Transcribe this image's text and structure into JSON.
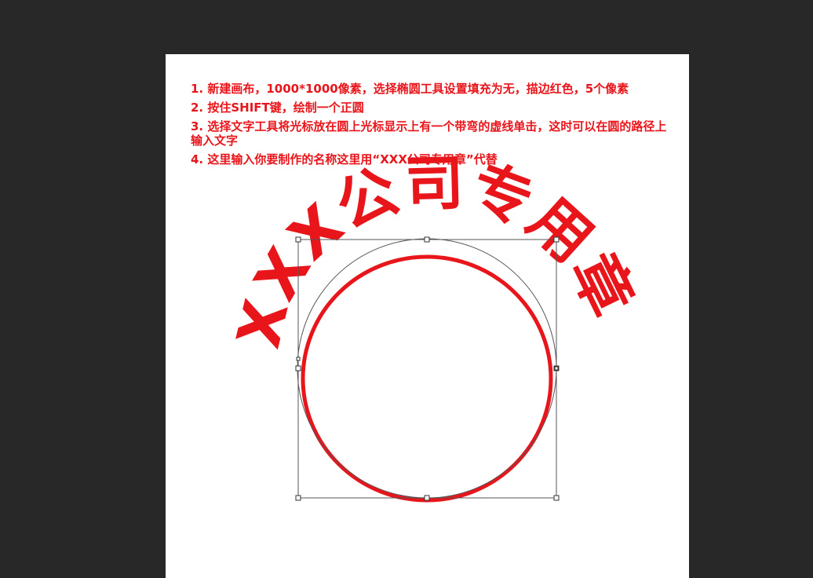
{
  "instructions": {
    "step1": "1. 新建画布，1000*1000像素，选择椭圆工具设置填充为无，描边红色，5个像素",
    "step2": "2. 按住SHIFT键，绘制一个正圆",
    "step3": "3. 选择文字工具将光标放在圆上光标显示上有一个带弯的虚线单击，这时可以在圆的路径上输入文字",
    "step4": "4. 这里输入你要制作的名称这里用“XXX公司专用章”代替"
  },
  "seal": {
    "text": "XXX公司专用章",
    "stroke_color": "#e8151b"
  },
  "colors": {
    "workspace": "#282828",
    "canvas": "#ffffff",
    "accent": "#e8151b"
  }
}
